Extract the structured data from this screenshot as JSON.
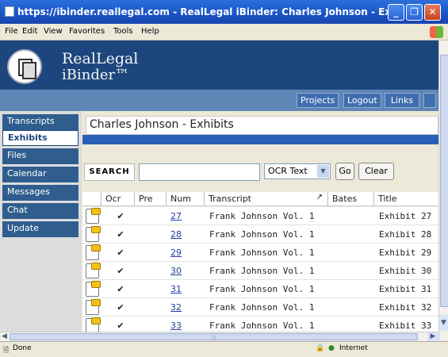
{
  "window": {
    "title": "https://ibinder.reallegal.com - RealLegal iBinder: Charles Johnson - Exhibits - Micr...",
    "controls": [
      "minimize-icon",
      "restore-icon",
      "close-icon"
    ]
  },
  "menu": [
    "File",
    "Edit",
    "View",
    "Favorites",
    "Tools",
    "Help"
  ],
  "brand": {
    "line1": "RealLegal",
    "line2": "iBinder™"
  },
  "topnav": [
    "Projects",
    "Logout",
    "Links"
  ],
  "sidebar": [
    "Transcripts",
    "Exhibits",
    "Files",
    "Calendar",
    "Messages",
    "Chat",
    "Update"
  ],
  "sidebar_active": "Exhibits",
  "page": {
    "title": "Charles Johnson - Exhibits"
  },
  "search": {
    "label": "Search",
    "input_value": "",
    "select_value": "OCR Text",
    "go_label": "Go",
    "clear_label": "Clear"
  },
  "table": {
    "columns": [
      "Ocr",
      "Pre",
      "Num",
      "Transcript",
      "Bates",
      "Title"
    ],
    "rows": [
      {
        "ocr": "✔",
        "pre": "",
        "num": "27",
        "transcript": "Frank Johnson Vol. 1",
        "bates": "",
        "title": "Exhibit 27"
      },
      {
        "ocr": "✔",
        "pre": "",
        "num": "28",
        "transcript": "Frank Johnson Vol. 1",
        "bates": "",
        "title": "Exhibit 28"
      },
      {
        "ocr": "✔",
        "pre": "",
        "num": "29",
        "transcript": "Frank Johnson Vol. 1",
        "bates": "",
        "title": "Exhibit 29"
      },
      {
        "ocr": "✔",
        "pre": "",
        "num": "30",
        "transcript": "Frank Johnson Vol. 1",
        "bates": "",
        "title": "Exhibit 30"
      },
      {
        "ocr": "✔",
        "pre": "",
        "num": "31",
        "transcript": "Frank Johnson Vol. 1",
        "bates": "",
        "title": "Exhibit 31"
      },
      {
        "ocr": "✔",
        "pre": "",
        "num": "32",
        "transcript": "Frank Johnson Vol. 1",
        "bates": "",
        "title": "Exhibit 32"
      },
      {
        "ocr": "✔",
        "pre": "",
        "num": "33",
        "transcript": "Frank Johnson Vol. 1",
        "bates": "",
        "title": "Exhibit 33"
      }
    ]
  },
  "status": {
    "left": "Done",
    "zone": "Internet"
  },
  "colors": {
    "banner": "#1d467e",
    "toolbar": "#5f86b5",
    "nav": "#2f5e8e",
    "accent_bar": "#2760b6"
  }
}
